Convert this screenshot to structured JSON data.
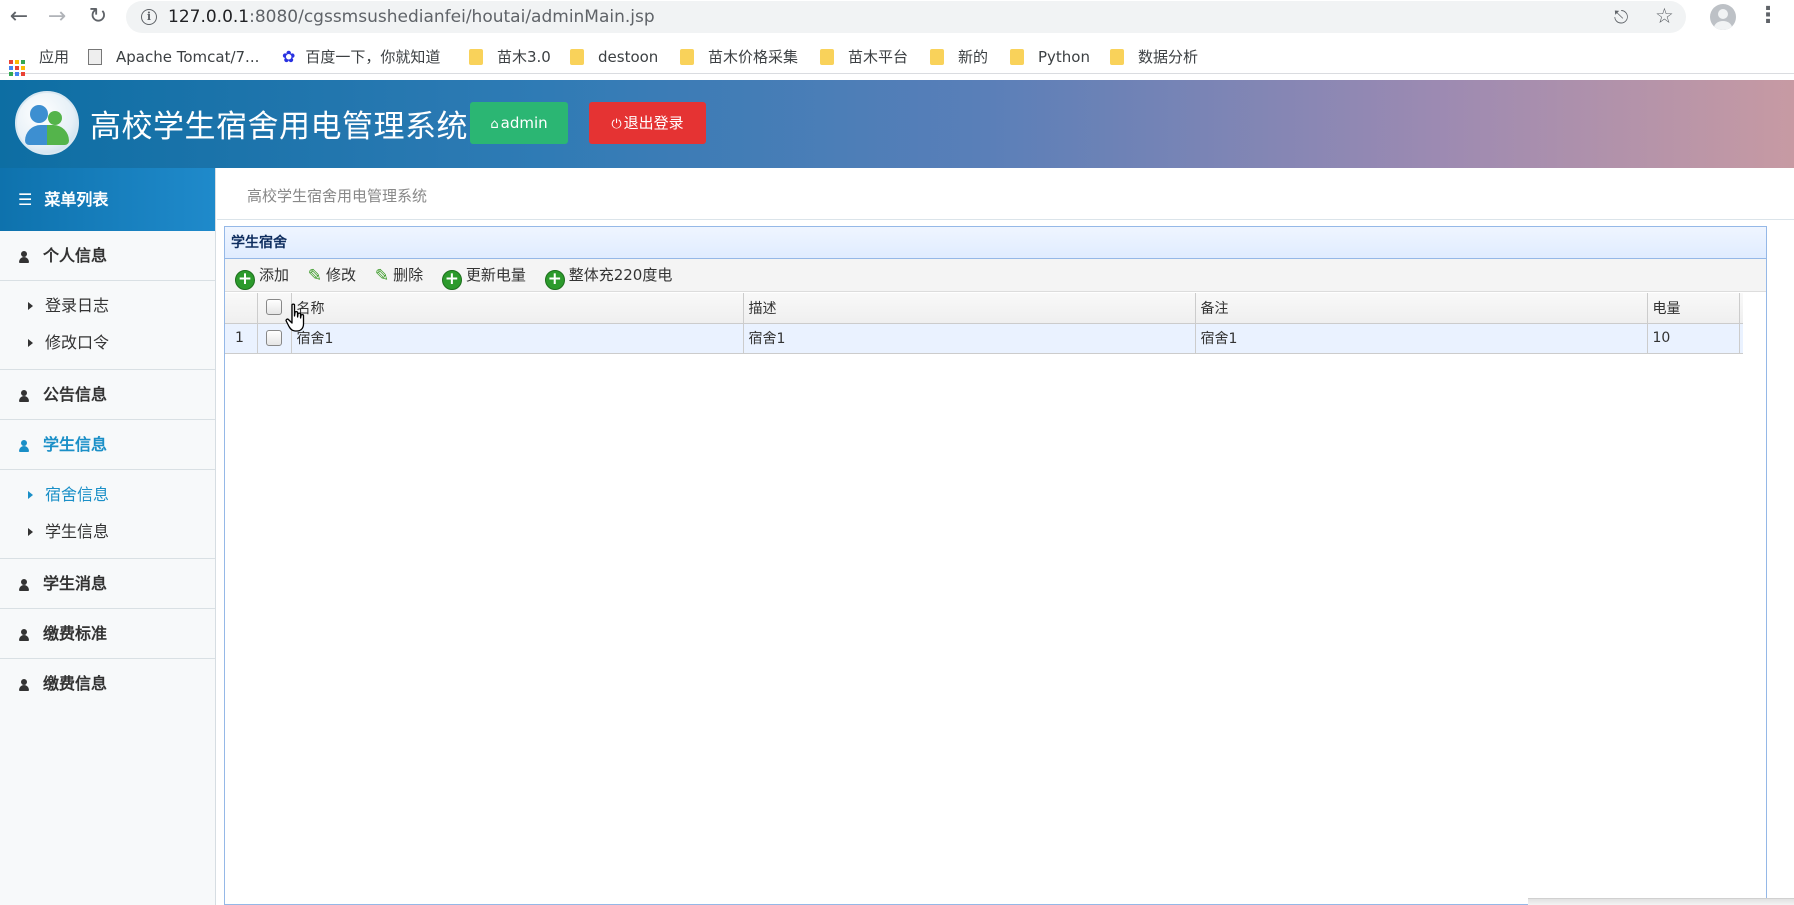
{
  "browser": {
    "url_host": "127.0.0.1",
    "url_rest": ":8080/cgssmsushedianfei/houtai/adminMain.jsp",
    "bookmarks": [
      "应用",
      "Apache Tomcat/7...",
      "百度一下，你就知道",
      "苗木3.0",
      "destoon",
      "苗木价格采集",
      "苗木平台",
      "新的",
      "Python",
      "数据分析"
    ]
  },
  "header": {
    "title": "高校学生宿舍用电管理系统",
    "admin_label": "admin",
    "logout_label": "退出登录"
  },
  "sidebar": {
    "heading": "菜单列表",
    "groups": [
      {
        "label": "个人信息",
        "items": [
          "登录日志",
          "修改口令"
        ]
      },
      {
        "label": "公告信息"
      },
      {
        "label": "学生信息",
        "items": [
          "宿舍信息",
          "学生信息"
        ]
      },
      {
        "label": "学生消息"
      },
      {
        "label": "缴费标准"
      },
      {
        "label": "缴费信息"
      }
    ]
  },
  "breadcrumb": "高校学生宿舍用电管理系统",
  "panel": {
    "title": "学生宿舍",
    "toolbar": [
      "添加",
      "修改",
      "删除",
      "更新电量",
      "整体充220度电"
    ]
  },
  "table": {
    "columns": [
      "名称",
      "描述",
      "备注",
      "电量"
    ],
    "rows": [
      {
        "index": "1",
        "name": "宿舍1",
        "description": "宿舍1",
        "remark": "宿舍1",
        "power": "10"
      }
    ]
  },
  "colors": {
    "header_start": "#0d6ea3",
    "admin_green": "#2bb673",
    "logout_red": "#e53333",
    "active_blue": "#1a8fc7",
    "panel_border": "#95b8e7"
  }
}
